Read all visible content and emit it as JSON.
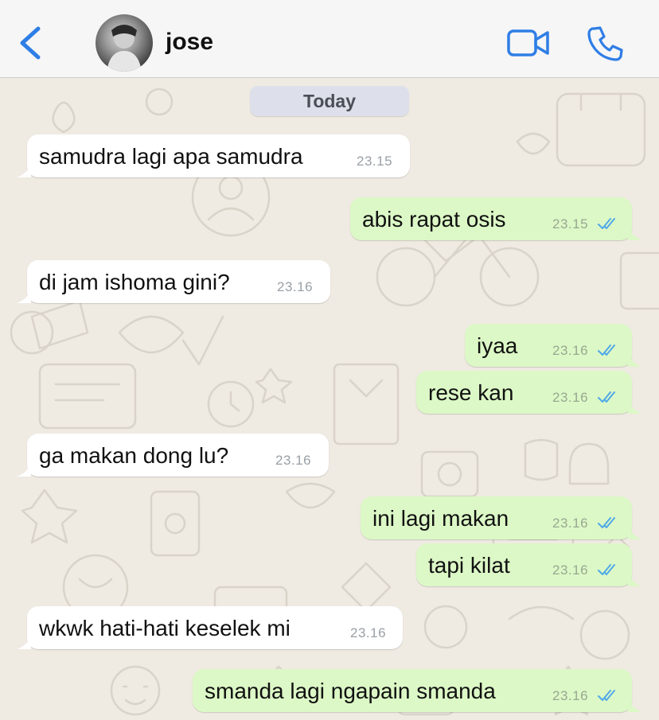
{
  "header": {
    "contact_name": "jose",
    "back_icon": "chevron-left-icon",
    "video_icon": "video-camera-icon",
    "call_icon": "phone-icon"
  },
  "colors": {
    "accent": "#2f7ee6",
    "outgoing_bubble": "#dcf8c6",
    "incoming_bubble": "#ffffff",
    "read_ticks": "#4fa8e8",
    "chat_background": "#efeae2"
  },
  "chat": {
    "date_label": "Today",
    "messages": [
      {
        "direction": "in",
        "text": "samudra lagi apa samudra",
        "time": "23.15"
      },
      {
        "direction": "out",
        "text": "abis rapat osis",
        "time": "23.15",
        "status": "read"
      },
      {
        "direction": "in",
        "text": "di jam ishoma gini?",
        "time": "23.16"
      },
      {
        "direction": "out",
        "text": "iyaa",
        "time": "23.16",
        "status": "read"
      },
      {
        "direction": "out",
        "text": "rese kan",
        "time": "23.16",
        "status": "read"
      },
      {
        "direction": "in",
        "text": "ga makan dong lu?",
        "time": "23.16"
      },
      {
        "direction": "out",
        "text": "ini lagi makan",
        "time": "23.16",
        "status": "read"
      },
      {
        "direction": "out",
        "text": "tapi kilat",
        "time": "23.16",
        "status": "read"
      },
      {
        "direction": "in",
        "text": "wkwk hati-hati keselek mi",
        "time": "23.16"
      },
      {
        "direction": "out",
        "text": "smanda lagi ngapain smanda",
        "time": "23.16",
        "status": "read"
      }
    ]
  }
}
